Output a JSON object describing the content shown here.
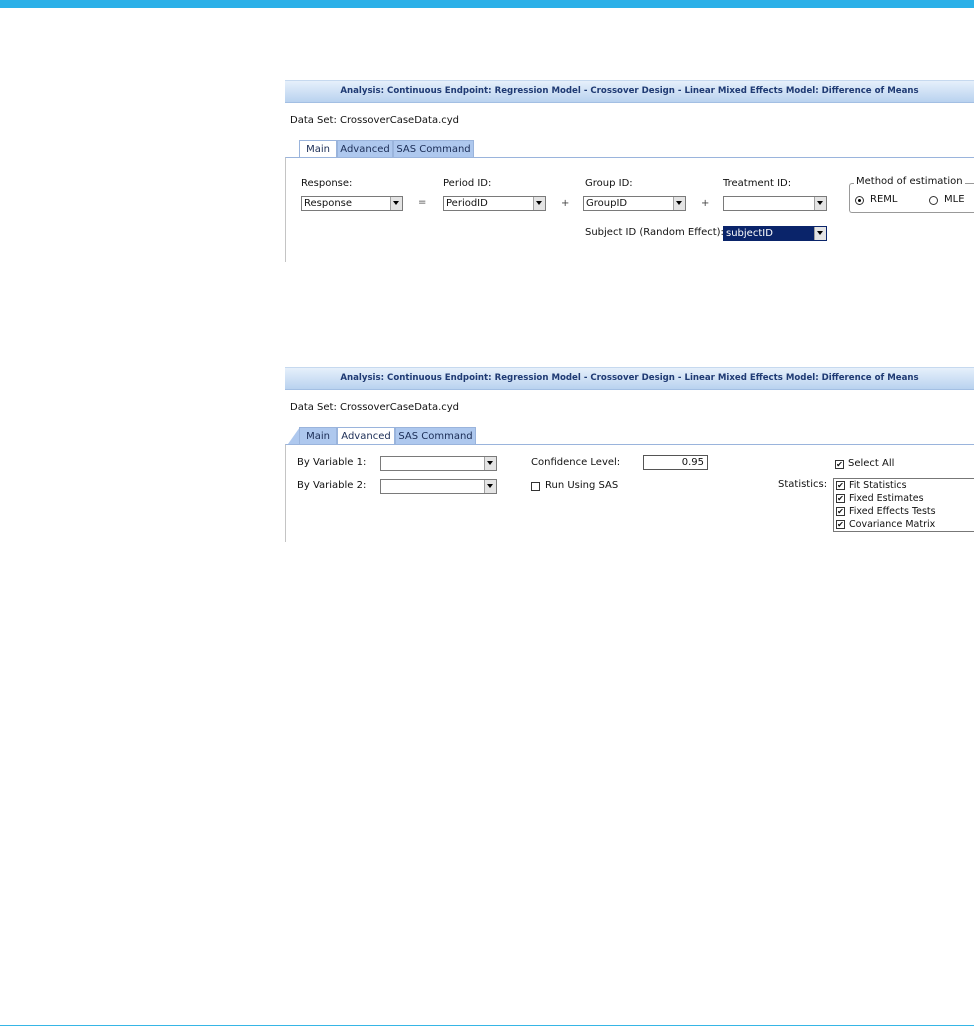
{
  "panel1": {
    "title": "Analysis: Continuous Endpoint: Regression Model - Crossover Design - Linear Mixed Effects Model: Difference of Means",
    "dataset": "Data Set: CrossoverCaseData.cyd",
    "tabs": {
      "main": "Main",
      "advanced": "Advanced",
      "sas": "SAS Command"
    },
    "active_tab": "Main",
    "labels": {
      "response": "Response:",
      "period": "Period ID:",
      "group": "Group ID:",
      "treatment": "Treatment ID:",
      "subject": "Subject ID (Random Effect):"
    },
    "operators": {
      "equals": "=",
      "plus1": "+",
      "plus2": "+"
    },
    "values": {
      "response": "Response",
      "period": "PeriodID",
      "group": "GroupID",
      "treatment": "",
      "subject": "subjectID"
    },
    "method": {
      "legend": "Method of estimation",
      "reml": "REML",
      "mle": "MLE",
      "selected": "REML"
    }
  },
  "panel2": {
    "title": "Analysis: Continuous Endpoint: Regression Model - Crossover Design - Linear Mixed Effects Model: Difference of Means",
    "dataset": "Data Set: CrossoverCaseData.cyd",
    "tabs": {
      "main": "Main",
      "advanced": "Advanced",
      "sas": "SAS Command"
    },
    "active_tab": "Advanced",
    "labels": {
      "by1": "By Variable 1:",
      "by2": "By Variable 2:",
      "confidence": "Confidence Level:",
      "run_sas": "Run Using SAS",
      "select_all": "Select All",
      "statistics": "Statistics:"
    },
    "values": {
      "by1": "",
      "by2": "",
      "confidence": "0.95"
    },
    "run_sas_checked": false,
    "select_all_checked": true,
    "statistics_items": [
      {
        "label": "Fit Statistics",
        "checked": true
      },
      {
        "label": "Fixed Estimates",
        "checked": true
      },
      {
        "label": "Fixed Effects Tests",
        "checked": true
      },
      {
        "label": "Covariance Matrix",
        "checked": true
      }
    ]
  },
  "colors": {
    "top_strip": "#2bb0e8",
    "title_text": "#1f3a73",
    "selection": "#0a246a",
    "tab_inactive": "#aec8ee"
  },
  "icons": {
    "check": "✔",
    "dropdown": "chevron-down-icon"
  }
}
